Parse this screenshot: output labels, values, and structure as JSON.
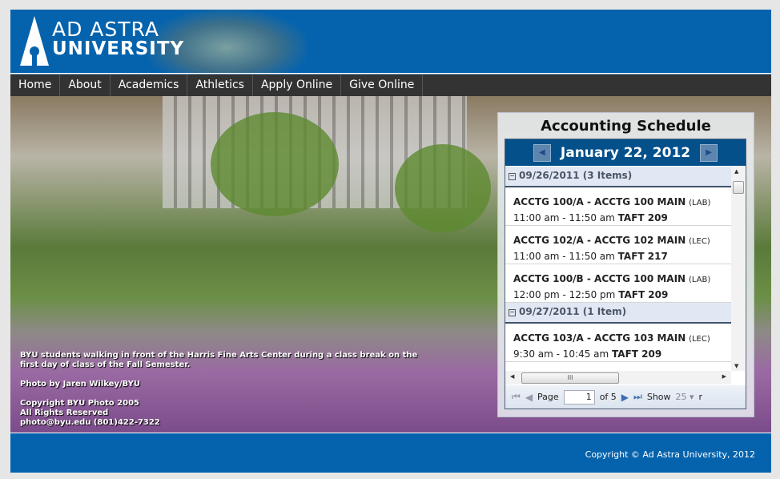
{
  "header": {
    "logo_line1": "AD ASTRA",
    "logo_line2": "UNIVERSITY"
  },
  "nav": [
    "Home",
    "About",
    "Academics",
    "Athletics",
    "Apply Online",
    "Give Online"
  ],
  "hero": {
    "caption": [
      "BYU students walking in front of the Harris Fine Arts Center during a class break on the",
      "first day of class of the Fall Semester."
    ],
    "credit": "Photo by Jaren Wilkey/BYU",
    "copyright": [
      "Copyright BYU Photo 2005",
      "All Rights Reserved",
      "photo@byu.edu (801)422-7322"
    ]
  },
  "schedule": {
    "title": "Accounting Schedule",
    "date": "January 22, 2012",
    "groups": [
      {
        "label": "09/26/2011 (3 Items)",
        "items": [
          {
            "course": "ACCTG 100/A - ACCTG 100 MAIN",
            "type": "(LAB)",
            "time": "11:00 am - 11:50 am",
            "room": "TAFT 209"
          },
          {
            "course": "ACCTG 102/A - ACCTG 102 MAIN",
            "type": "(LEC)",
            "time": "11:00 am - 11:50 am",
            "room": "TAFT 217"
          },
          {
            "course": "ACCTG 100/B - ACCTG 100 MAIN",
            "type": "(LAB)",
            "time": "12:00 pm - 12:50 pm",
            "room": "TAFT 209"
          }
        ]
      },
      {
        "label": "09/27/2011 (1 Item)",
        "items": [
          {
            "course": "ACCTG 103/A - ACCTG 103 MAIN",
            "type": "(LEC)",
            "time": "9:30 am - 10:45 am",
            "room": "TAFT 209"
          }
        ]
      }
    ],
    "pager": {
      "page_label": "Page",
      "page": "1",
      "of": "of 5",
      "show_label": "Show",
      "show_value": "25 ▾",
      "trail": "r"
    }
  },
  "footer": {
    "copyright": "Copyright © Ad Astra University, 2012"
  }
}
